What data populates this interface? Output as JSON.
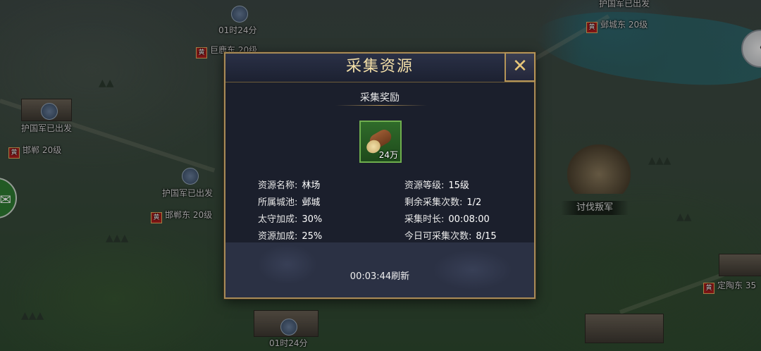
{
  "map": {
    "labels": [
      {
        "id": "timer-top",
        "text": "01时24分"
      },
      {
        "id": "city-top",
        "text": "巨鹿东 20级"
      },
      {
        "id": "depart-left",
        "text": "护国军已出发"
      },
      {
        "id": "city-left",
        "text": "邯郸 20级"
      },
      {
        "id": "depart-center",
        "text": "护国军已出发"
      },
      {
        "id": "city-center",
        "text": "邯郸东 20级"
      },
      {
        "id": "depart-topright",
        "text": "护国军已出发"
      },
      {
        "id": "city-topright",
        "text": "邺城东 20级"
      },
      {
        "id": "city-right",
        "text": "定陶东 35"
      },
      {
        "id": "timer-bottom",
        "text": "01时24分"
      }
    ],
    "rebel_label": "讨伐叛军"
  },
  "dialog": {
    "title": "采集资源",
    "section_title": "采集奖励",
    "reward": {
      "icon": "wood-log-icon",
      "count": "24万"
    },
    "info_left": [
      {
        "label": "资源名称:",
        "value": "林场"
      },
      {
        "label": "所属城池:",
        "value": "邺城"
      },
      {
        "label": "太守加成:",
        "value": "30%"
      },
      {
        "label": "资源加成:",
        "value": "25%"
      }
    ],
    "info_right": [
      {
        "label": "资源等级:",
        "value": "15级"
      },
      {
        "label": "剩余采集次数:",
        "value": "1/2"
      },
      {
        "label": "采集时长:",
        "value": "00:08:00"
      },
      {
        "label": "今日可采集次数:",
        "value": "8/15"
      }
    ],
    "refresh_text": "00:03:44刷新"
  },
  "colors": {
    "title_gold": "#f3dfa8",
    "frame_gold": "#a88b57",
    "panel_bg": "#1b1f2c",
    "footer_bg": "#2b3144",
    "reward_green": "#2f6b2a"
  }
}
